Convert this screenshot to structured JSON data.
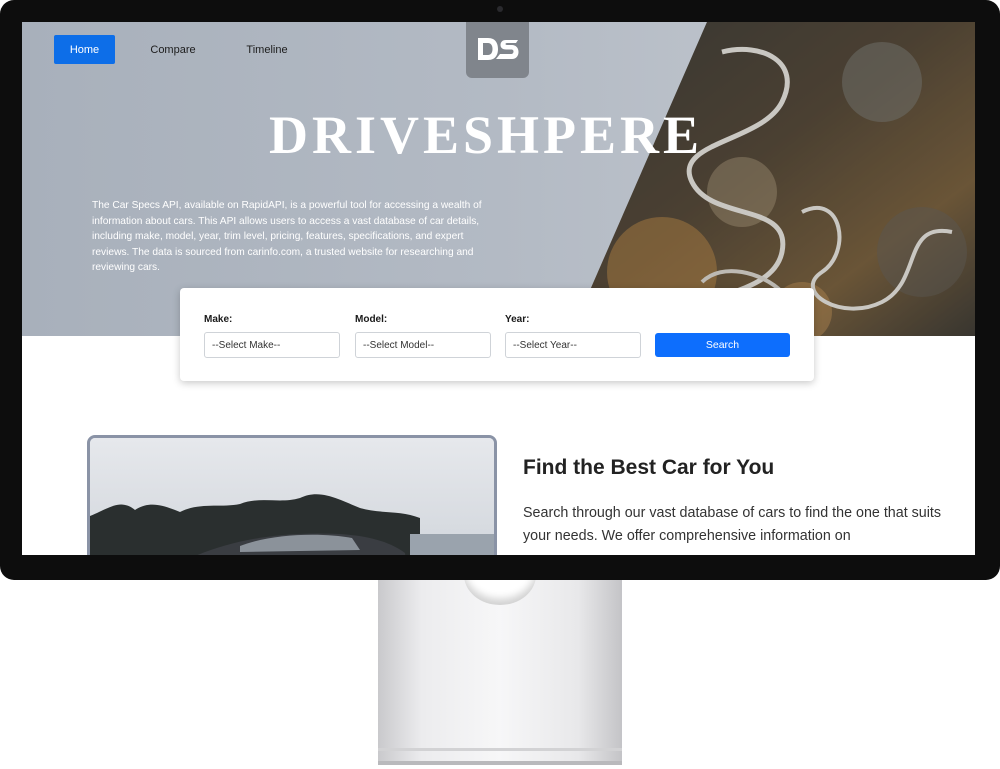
{
  "nav": {
    "home": "Home",
    "compare": "Compare",
    "timeline": "Timeline"
  },
  "logo": {
    "text": "DS"
  },
  "hero": {
    "title": "DRIVESHPERE",
    "description": "The Car Specs API, available on RapidAPI, is a powerful tool for accessing a wealth of information about cars. This API allows users to access a vast database of car details, including make, model, year, trim level, pricing, features, specifications, and expert reviews. The data is sourced from carinfo.com, a trusted website for researching and reviewing cars."
  },
  "search": {
    "make_label": "Make:",
    "make_value": "--Select Make--",
    "model_label": "Model:",
    "model_value": "--Select Model--",
    "year_label": "Year:",
    "year_value": "--Select Year--",
    "button_label": "Search"
  },
  "section": {
    "heading": "Find the Best Car for You",
    "text": "Search through our vast database of cars to find the one that suits your needs. We offer comprehensive information on"
  },
  "colors": {
    "accent": "#0d6efd",
    "hero_bg": "#b3bac4",
    "bezel": "#0d0d0d"
  },
  "icons": [
    "camera-icon",
    "ds-logo-icon"
  ]
}
